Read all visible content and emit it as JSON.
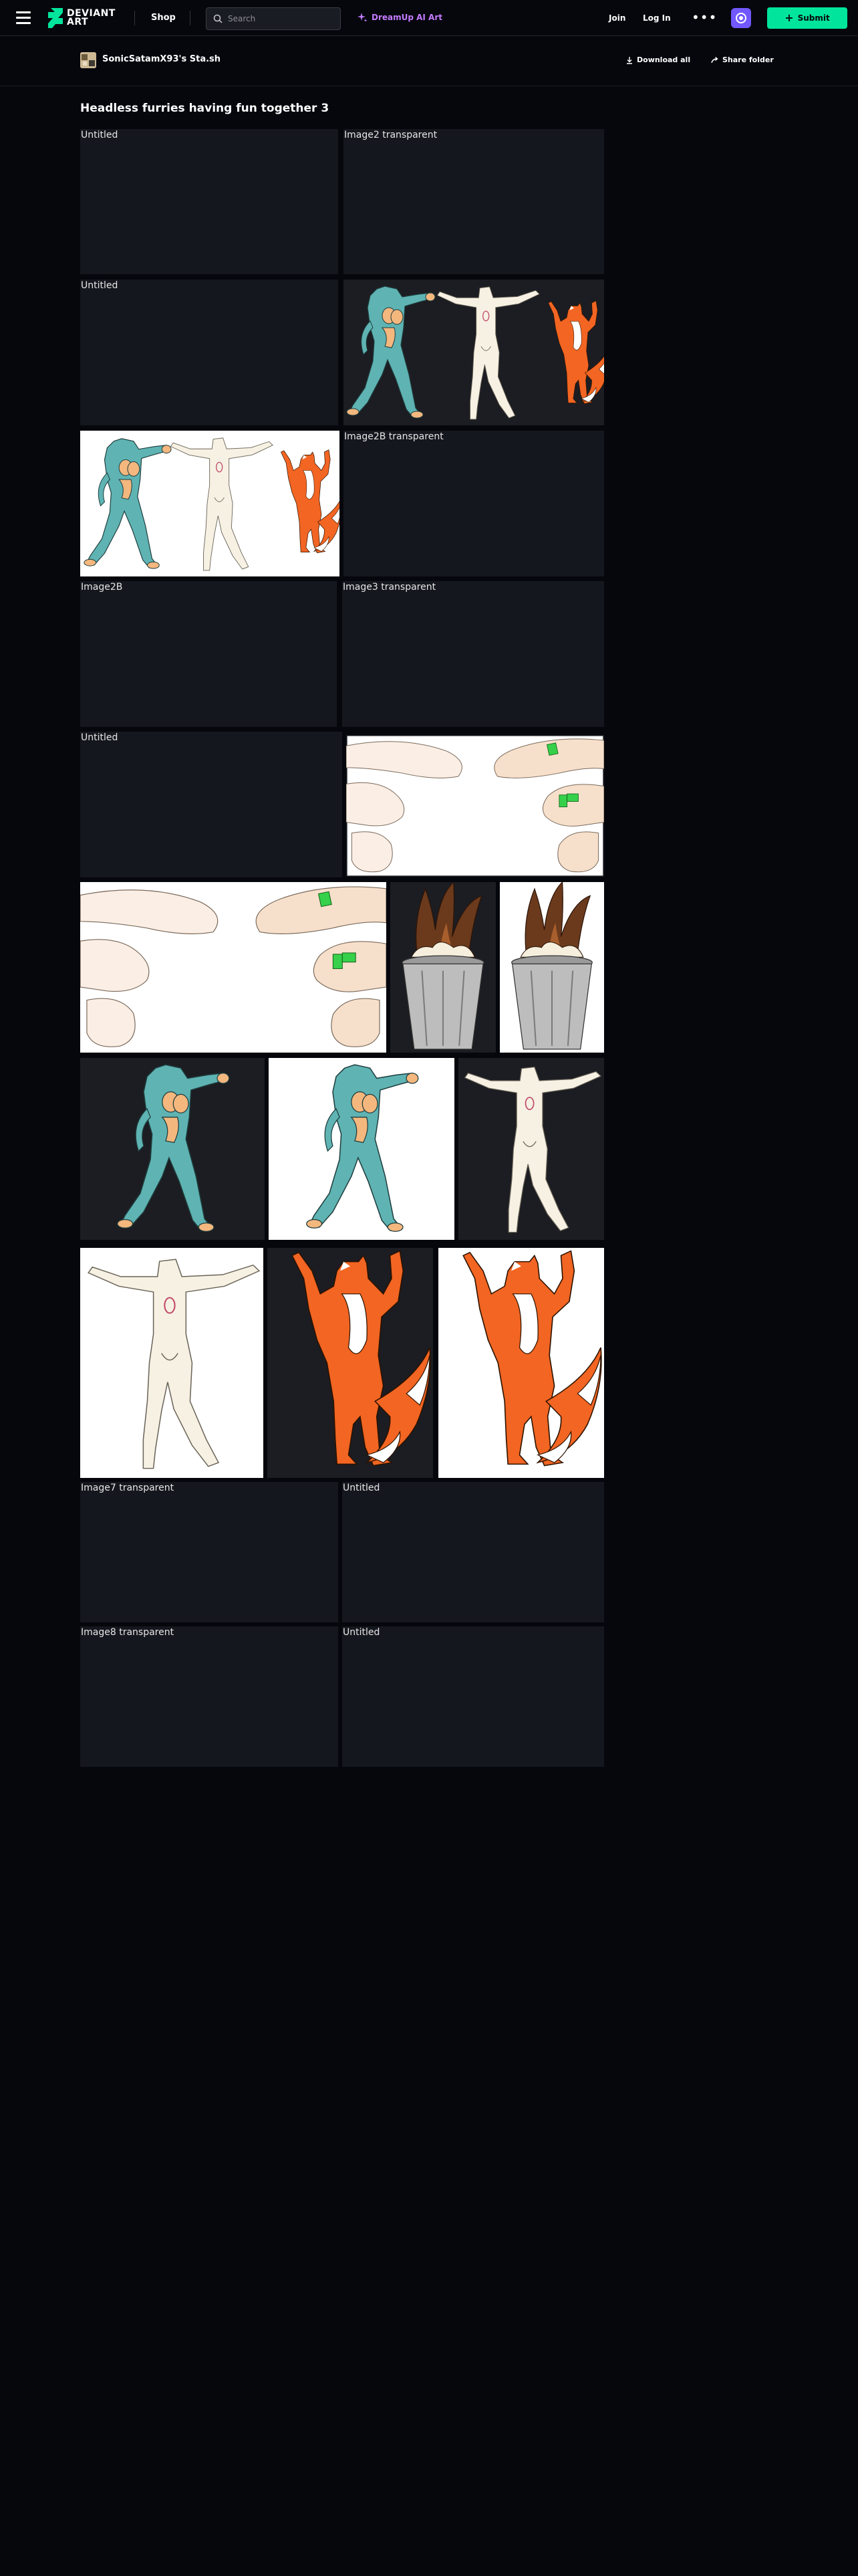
{
  "nav": {
    "shop": "Shop",
    "search_placeholder": "Search",
    "dreamup": "DreamUp AI Art",
    "join": "Join",
    "login": "Log In",
    "submit": "Submit",
    "logo_line1": "DEVIANT",
    "logo_line2": "ART",
    "more": "•••"
  },
  "folder": {
    "owner": "SonicSatamX93's Sta.sh",
    "download_all": "Download all",
    "share_folder": "Share folder",
    "title": "Headless furries having fun together 3"
  },
  "tiles": [
    {
      "alt": "Untitled",
      "loaded": false
    },
    {
      "alt": "Image2 transparent",
      "loaded": false
    },
    {
      "alt": "Untitled",
      "loaded": false
    },
    {
      "alt": "",
      "loaded": true,
      "subject": "three headless characters, dark background"
    },
    {
      "alt": "",
      "loaded": true,
      "subject": "three headless characters, white background"
    },
    {
      "alt": "Image2B transparent",
      "loaded": false
    },
    {
      "alt": "Image2B",
      "loaded": false
    },
    {
      "alt": "Image3 transparent",
      "loaded": false
    },
    {
      "alt": "Untitled",
      "loaded": false
    },
    {
      "alt": "",
      "loaded": true,
      "subject": "feet close-up, dark background"
    },
    {
      "alt": "",
      "loaded": true,
      "subject": "feet close-up, white background"
    },
    {
      "alt": "",
      "loaded": true,
      "subject": "tail in trash can, dark"
    },
    {
      "alt": "",
      "loaded": true,
      "subject": "tail in trash can, white"
    },
    {
      "alt": "",
      "loaded": true,
      "subject": "teal character, dark"
    },
    {
      "alt": "",
      "loaded": true,
      "subject": "teal character, white"
    },
    {
      "alt": "",
      "loaded": true,
      "subject": "cream character, dark"
    },
    {
      "alt": "",
      "loaded": true,
      "subject": "cream character, white"
    },
    {
      "alt": "",
      "loaded": true,
      "subject": "orange fox, dark"
    },
    {
      "alt": "",
      "loaded": true,
      "subject": "orange fox, white"
    },
    {
      "alt": "Image7 transparent",
      "loaded": false
    },
    {
      "alt": "Untitled",
      "loaded": false
    },
    {
      "alt": "Image8 transparent",
      "loaded": false
    },
    {
      "alt": "Untitled",
      "loaded": false
    }
  ],
  "colors": {
    "bg": "#06070d",
    "accent_green": "#00e59b",
    "dreamup_purple": "#c37bff",
    "core_badge": "#7158ff",
    "teal": "#5fb3b3",
    "cream": "#f6f1e3",
    "fox_orange": "#f26522"
  }
}
